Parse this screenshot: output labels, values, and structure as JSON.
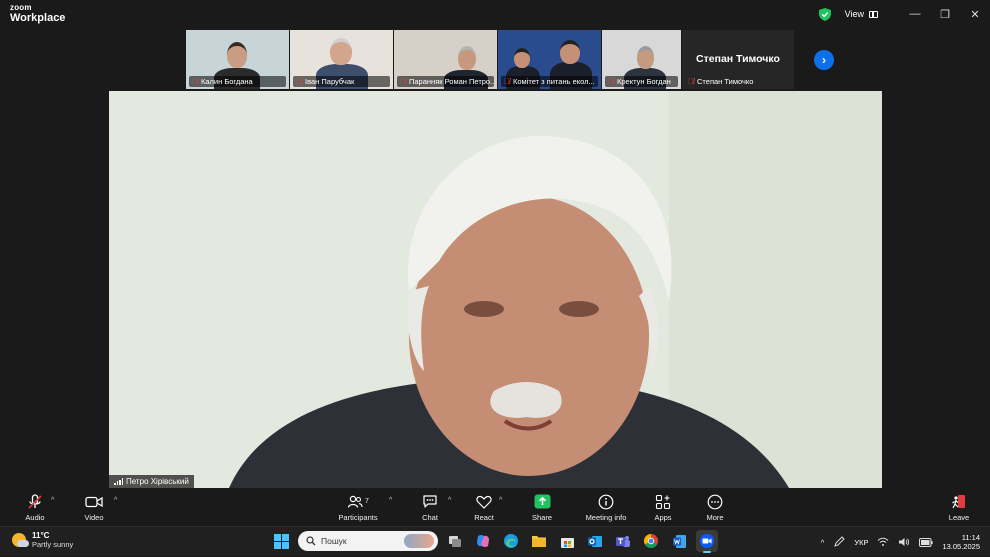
{
  "app": {
    "logo_line1": "zoom",
    "logo_line2": "Workplace"
  },
  "titlebar": {
    "view_label": "View",
    "minimize": "—",
    "restore": "❐",
    "close": "✕"
  },
  "thumbnails": [
    {
      "name": "Калин Богдана",
      "bg": "#c7d5d8",
      "skin": "#c99d84",
      "shirt": "#2b2b2b",
      "hair": "#3b2a20"
    },
    {
      "name": "Іван Парубчак",
      "bg": "#e7e2dc",
      "skin": "#d2a58c",
      "shirt": "#3e4f6b",
      "hair": "#cfcfcf"
    },
    {
      "name": "Паранняк Роман Петро...",
      "bg": "#d6d0c8",
      "skin": "#c6997f",
      "shirt": "#1f2530",
      "hair": "#b3b3b3"
    },
    {
      "name": "Комітет з питань екол...",
      "bg": "#2a4c8e",
      "skin": "#c49078",
      "shirt": "#1b1f2a",
      "hair": "#222222"
    },
    {
      "name": "Кректун Богдан",
      "bg": "#d8d8d8",
      "skin": "#c49a80",
      "shirt": "#2c3440",
      "hair": "#9a9a9a"
    }
  ],
  "text_tile": {
    "big_name": "Степан Тимочко",
    "name": "Степан Тимочко"
  },
  "main": {
    "speaker": "Петро Хірівський"
  },
  "toolbar": {
    "audio": "Audio",
    "video": "Video",
    "participants": "Participants",
    "participants_count": "7",
    "chat": "Chat",
    "react": "React",
    "share": "Share",
    "meeting_info": "Meeting info",
    "apps": "Apps",
    "more": "More",
    "leave": "Leave"
  },
  "taskbar": {
    "temp": "11°C",
    "condition": "Partly sunny",
    "search_placeholder": "Пошук",
    "lang": "УКР",
    "time": "11:14",
    "date": "13.05.2025"
  },
  "colors": {
    "accent_blue": "#0e71eb",
    "share_green": "#23c261",
    "mute_red": "#e23d3d"
  }
}
